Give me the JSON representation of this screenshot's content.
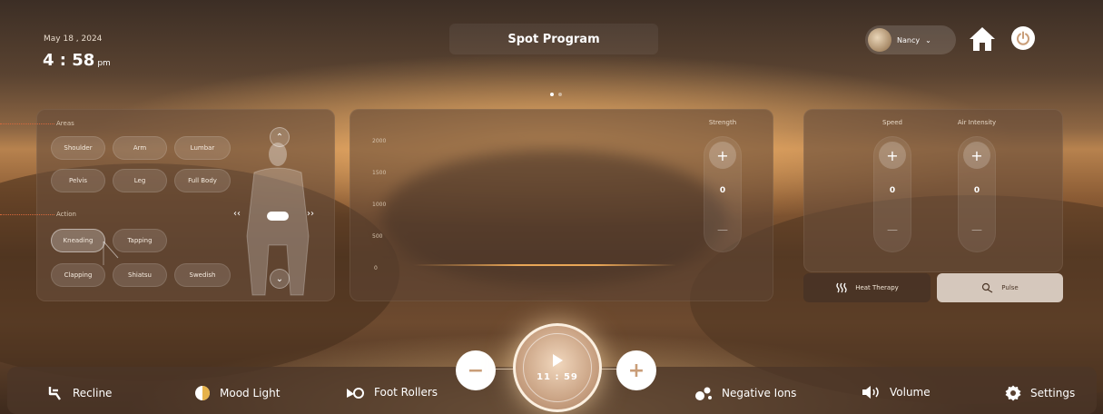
{
  "status": {
    "date": "May 18 , 2024",
    "time": "4 : 58",
    "ampm": "pm"
  },
  "header": {
    "title": "Spot Program"
  },
  "user": {
    "name": "Nancy"
  },
  "areas": {
    "label": "Areas",
    "items": [
      "Shoulder",
      "Arm",
      "Lumbar",
      "Pelvis",
      "Leg",
      "Full Body"
    ]
  },
  "action": {
    "label": "Action",
    "items": [
      "Kneading",
      "Tapping",
      "Clapping",
      "Shiatsu",
      "Swedish"
    ],
    "selected": "Kneading"
  },
  "chart": {
    "yticks": [
      "2000",
      "1500",
      "1000",
      "500",
      "0"
    ]
  },
  "strength": {
    "label": "Strength",
    "value": "0",
    "plus": "+",
    "minus": "—"
  },
  "speed": {
    "label": "Speed",
    "value": "0",
    "plus": "+",
    "minus": "—"
  },
  "air_intensity": {
    "label": "Air Intensity",
    "value": "0",
    "plus": "+",
    "minus": "—"
  },
  "toggles": {
    "heat": "Heat Therapy",
    "pulse": "Pulse"
  },
  "session": {
    "timer": "11 : 59",
    "decrease": "−",
    "increase": "+"
  },
  "bottom_nav": {
    "recline": "Recline",
    "mood_light": "Mood Light",
    "foot_rollers": "Foot Rollers",
    "negative_ions": "Negative Ions",
    "volume": "Volume",
    "settings": "Settings"
  },
  "colors": {
    "accent": "#c99d78",
    "leader": "#d6693c"
  }
}
